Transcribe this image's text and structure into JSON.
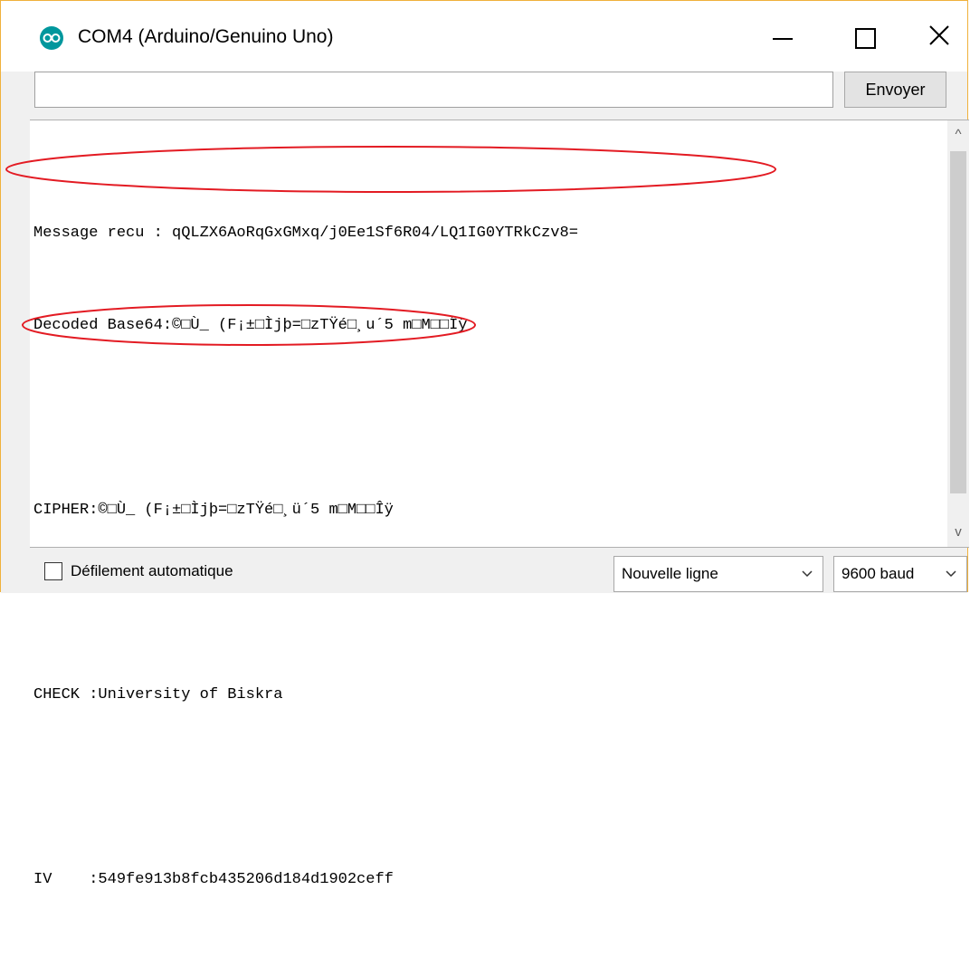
{
  "window": {
    "title": "COM4 (Arduino/Genuino Uno)",
    "controls": {
      "minimize": "minimize",
      "maximize": "maximize",
      "close": "close"
    },
    "accent_border": "#f0b13b",
    "app_icon_color": "#00979d"
  },
  "send": {
    "input_value": "",
    "input_placeholder": "",
    "button_label": "Envoyer"
  },
  "output": {
    "lines": [
      "Message recu : qQLZX6AoRqGxGMxq/j0Ee1Sf6R04/LQ1IG0YTRkCzv8=",
      "Decoded Base64:©□Ù_ (F¡±□Ìjþ=□zTŸé□¸u´5 m□M□□Îÿ",
      "",
      "CIPHER:©□Ù_ (F¡±□Ìjþ=□zTŸé□¸ü´5 m□M□□Îÿ",
      "",
      "CHECK :University of Biskra",
      "",
      "IV    :549fe913b8fcb435206d184d1902ceff"
    ],
    "annotation_color": "#e31b23"
  },
  "status": {
    "autoscroll_label": "Défilement automatique",
    "autoscroll_checked": false,
    "line_ending": "Nouvelle ligne",
    "baud_rate": "9600 baud"
  }
}
